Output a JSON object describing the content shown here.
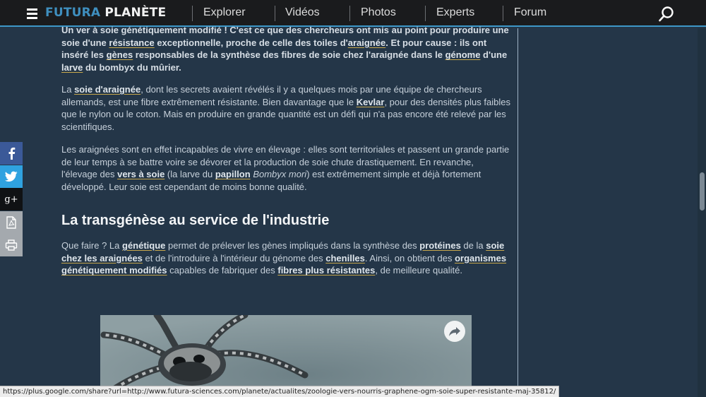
{
  "header": {
    "logo": {
      "part1": "FUTURA",
      "part2": "PLANÈTE"
    },
    "nav": [
      "Explorer",
      "Vidéos",
      "Photos",
      "Experts",
      "Forum"
    ]
  },
  "article": {
    "lead": [
      "Un ver à soie génétiquement modifié ! C'est ce que des chercheurs ont mis au point pour produire une soie d'une ",
      "résistance",
      " exceptionnelle, proche de celle des toiles d'",
      "araignée",
      ". Et pour cause : ils ont inséré les ",
      "gènes",
      " responsables de la synthèse des fibres de soie chez l'araignée dans le ",
      "génome",
      " d'une ",
      "larve",
      " du bombyx du mûrier."
    ],
    "p1": [
      "La ",
      "soie d'araignée",
      ", dont les secrets avaient révélés il y a quelques mois par une équipe de chercheurs allemands, est une fibre extrêmement résistante. Bien davantage que le ",
      "Kevlar",
      ", pour des densités plus faibles que le nylon ou le coton. Mais en produire en grande quantité est un défi qui n'a pas encore été relevé par les scientifiques."
    ],
    "p2": [
      "Les araignées sont en effet incapables de vivre en élevage : elles sont territoriales et passent un grande partie de leur temps à se battre voire se dévorer et la production de soie chute drastiquement. En revanche, l'élevage des ",
      "vers à soie",
      " (la larve du ",
      "papillon",
      " ",
      "Bombyx mori",
      ") est extrêmement simple et déjà fortement développé. Leur soie est cependant de moins bonne qualité."
    ],
    "section_title": "La transgénèse au service de l'industrie",
    "p3": [
      "Que faire ? La ",
      "génétique",
      " permet de prélever les gènes impliqués dans la synthèse des ",
      "protéines",
      " de la ",
      "soie chez les araignées",
      " et de l'introduire à l'intérieur du génome des ",
      "chenilles",
      ". Ainsi, on obtient des ",
      "organismes génétiquement modifiés",
      " capables de fabriquer des ",
      "fibres plus résistantes",
      ", de meilleure qualité."
    ]
  },
  "share": {
    "facebook": "facebook-icon",
    "twitter": "twitter-icon",
    "google_plus": "g+",
    "pdf": "pdf-icon",
    "print": "print-icon"
  },
  "status_url": "https://plus.google.com/share?url=http://www.futura-sciences.com/planete/actualites/zoologie-vers-nourris-graphene-ogm-soie-super-resistante-maj-35812/",
  "colors": {
    "page_bg": "#243648",
    "nav_bg": "#1a1b1d",
    "brand_blue": "#3f8fbf",
    "link_underline": "#c8a84c"
  }
}
